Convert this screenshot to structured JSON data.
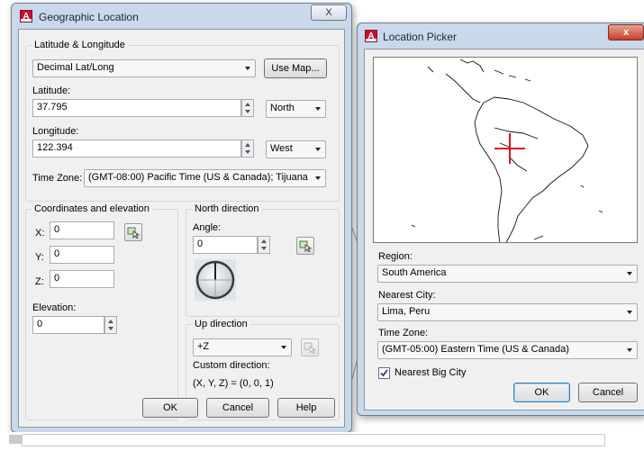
{
  "geo_dialog": {
    "title": "Geographic Location",
    "close_glyph": "X",
    "latlong_group": {
      "label": "Latitude & Longitude",
      "format_value": "Decimal Lat/Long",
      "use_map_label": "Use Map...",
      "latitude_label": "Latitude:",
      "latitude_value": "37.795",
      "latitude_dir": "North",
      "longitude_label": "Longitude:",
      "longitude_value": "122.394",
      "longitude_dir": "West",
      "timezone_label": "Time Zone:",
      "timezone_value": "(GMT-08:00) Pacific Time (US & Canada); Tijuana"
    },
    "coords_group": {
      "label": "Coordinates and elevation",
      "x_label": "X:",
      "x_value": "0",
      "y_label": "Y:",
      "y_value": "0",
      "z_label": "Z:",
      "z_value": "0",
      "elevation_label": "Elevation:",
      "elevation_value": "0"
    },
    "north_group": {
      "label": "North direction",
      "angle_label": "Angle:",
      "angle_value": "0"
    },
    "up_group": {
      "label": "Up direction",
      "value": "+Z",
      "custom_label": "Custom direction:",
      "custom_value": "(X, Y, Z) = (0, 0, 1)"
    },
    "buttons": {
      "ok": "OK",
      "cancel": "Cancel",
      "help": "Help"
    }
  },
  "location_picker": {
    "title": "Location Picker",
    "close_glyph": "x",
    "region_label": "Region:",
    "region_value": "South America",
    "city_label": "Nearest City:",
    "city_value": "Lima, Peru",
    "timezone_label": "Time Zone:",
    "timezone_value": "(GMT-05:00) Eastern Time (US & Canada)",
    "nearest_big_city_label": "Nearest Big City",
    "nearest_big_city_checked": true,
    "buttons": {
      "ok": "OK",
      "cancel": "Cancel"
    }
  },
  "icons": {
    "app": "autocad-app-icon",
    "pick": "pick-point-icon",
    "compass": "north-compass-icon",
    "crosshair": "location-crosshair-icon"
  },
  "colors": {
    "accent_red": "#c8102e",
    "window_frame": "#c9d9ea",
    "dialog_bg": "#f0f0f0"
  }
}
